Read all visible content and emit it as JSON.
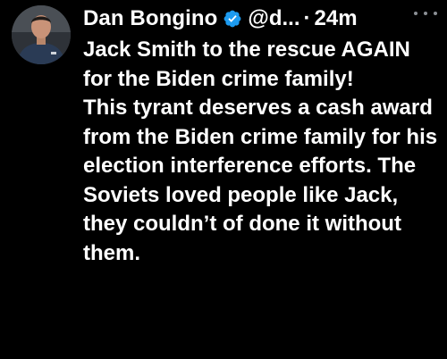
{
  "post": {
    "author_name": "Dan Bongino",
    "handle": "@d...",
    "separator": "·",
    "time": "24m",
    "paragraphs": [
      "Jack Smith to the rescue AGAIN for the Biden crime family!",
      "This tyrant deserves a cash award from the Biden crime family for his election interference efforts. The Soviets loved people like Jack, they couldn’t of done it without them."
    ],
    "icons": {
      "verified": "verified-badge-icon",
      "more": "more-options-icon"
    }
  },
  "colors": {
    "background": "#000000",
    "text": "#ffffff",
    "verified": "#1d9bf0",
    "muted": "#8b8f94"
  }
}
